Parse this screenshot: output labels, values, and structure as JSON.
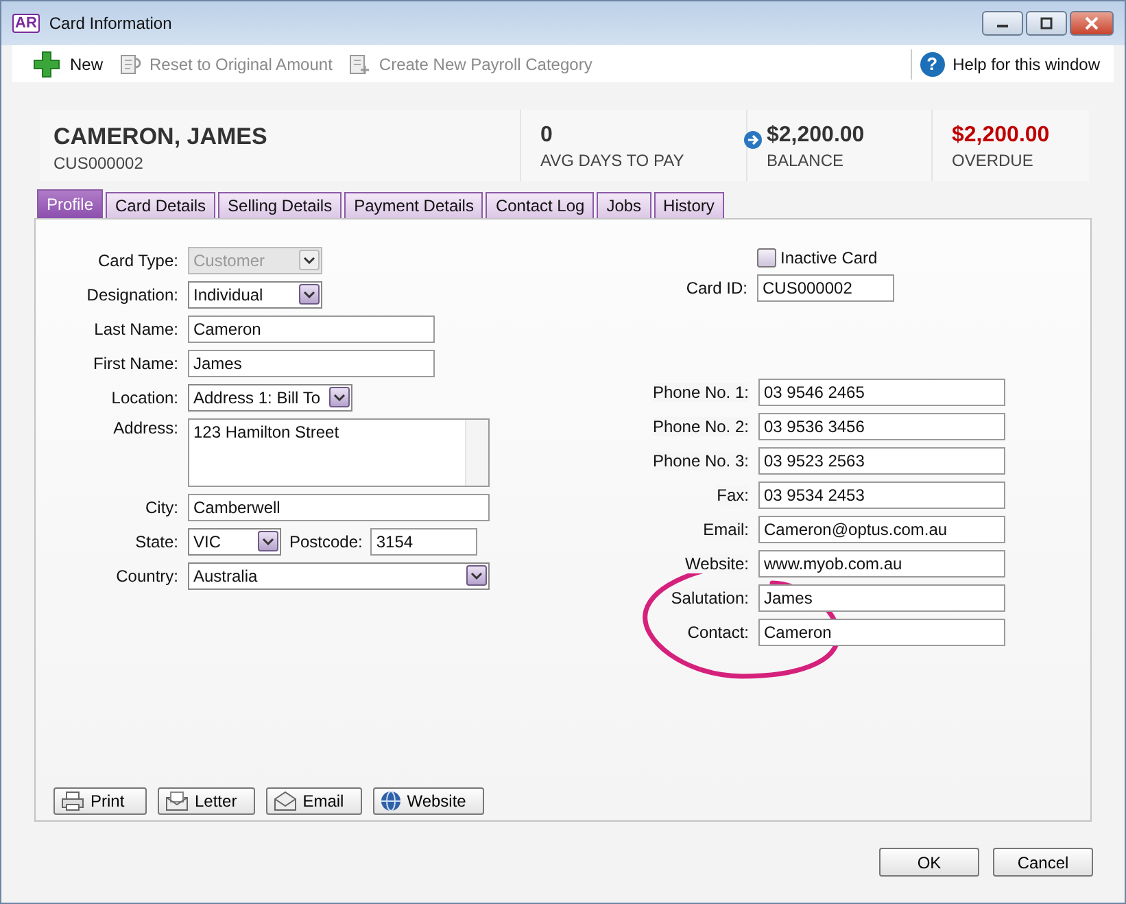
{
  "window": {
    "logo": "AR",
    "title": "Card Information"
  },
  "toolbar": [
    {
      "label": "New",
      "kind": "new",
      "disabled": false
    },
    {
      "label": "Reset to Original Amount",
      "kind": "reset",
      "disabled": true
    },
    {
      "label": "Create New Payroll Category",
      "kind": "payroll",
      "disabled": true
    }
  ],
  "help": {
    "icon": "?",
    "label": "Help for this window"
  },
  "header": {
    "name": "CAMERON, JAMES",
    "id": "CUS000002",
    "stats": [
      {
        "value": "0",
        "label": "AVG DAYS TO PAY",
        "kind": "plain"
      },
      {
        "value": "$2,200.00",
        "label": "BALANCE",
        "kind": "balance"
      },
      {
        "value": "$2,200.00",
        "label": "OVERDUE",
        "kind": "overdue"
      }
    ]
  },
  "tabs": [
    {
      "label": "Profile",
      "selected": true
    },
    {
      "label": "Card Details",
      "selected": false
    },
    {
      "label": "Selling Details",
      "selected": false
    },
    {
      "label": "Payment Details",
      "selected": false
    },
    {
      "label": "Contact Log",
      "selected": false
    },
    {
      "label": "Jobs",
      "selected": false
    },
    {
      "label": "History",
      "selected": false
    }
  ],
  "left_fields": [
    {
      "label": "Card Type:",
      "value": "Customer",
      "kind": "select",
      "disabled": true
    },
    {
      "label": "Designation:",
      "value": "Individual",
      "kind": "select",
      "disabled": false
    },
    {
      "label": "Last Name:",
      "value": "Cameron",
      "kind": "text",
      "disabled": false
    },
    {
      "label": "First Name:",
      "value": "James",
      "kind": "text",
      "disabled": false
    },
    {
      "label": "Location:",
      "value": "Address 1: Bill To",
      "kind": "select",
      "disabled": false
    },
    {
      "label": "Address:",
      "value": "123 Hamilton Street",
      "kind": "textarea",
      "disabled": false
    },
    {
      "label": "City:",
      "value": "Camberwell",
      "kind": "text",
      "disabled": false
    },
    {
      "label": "State:",
      "value": "VIC",
      "kind": "select",
      "disabled": false,
      "postcode": {
        "label": "Postcode:",
        "value": "3154"
      }
    },
    {
      "label": "Country:",
      "value": "Australia",
      "kind": "select",
      "disabled": false
    }
  ],
  "inactive": {
    "label": "Inactive Card",
    "checked": false
  },
  "card_id": {
    "label": "Card ID:",
    "value": "CUS000002"
  },
  "right_fields": [
    {
      "label": "Phone No. 1:",
      "value": "03 9546 2465"
    },
    {
      "label": "Phone No. 2:",
      "value": "03 9536 3456"
    },
    {
      "label": "Phone No. 3:",
      "value": "03 9523 2563"
    },
    {
      "label": "Fax:",
      "value": "03 9534 2453"
    },
    {
      "label": "Email:",
      "value": "Cameron@optus.com.au"
    },
    {
      "label": "Website:",
      "value": "www.myob.com.au"
    },
    {
      "label": "Salutation:",
      "value": "James"
    },
    {
      "label": "Contact:",
      "value": "Cameron"
    }
  ],
  "actions": [
    {
      "label": "Print",
      "kind": "print"
    },
    {
      "label": "Letter",
      "kind": "letter"
    },
    {
      "label": "Email",
      "kind": "email"
    },
    {
      "label": "Website",
      "kind": "website"
    }
  ],
  "buttons": [
    "OK",
    "Cancel"
  ]
}
